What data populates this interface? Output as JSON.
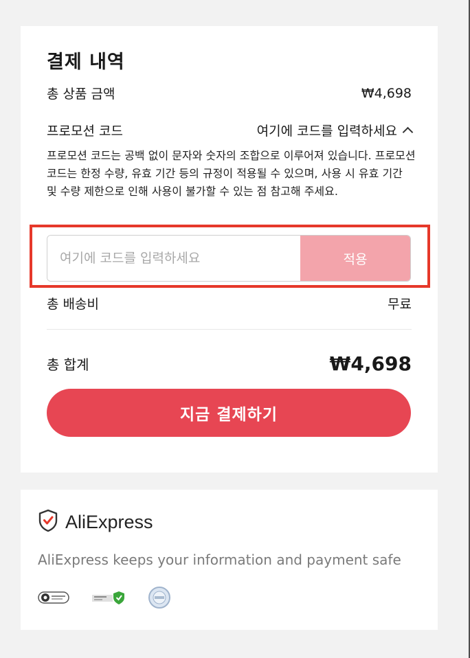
{
  "summary": {
    "title": "결제 내역",
    "items_label": "총 상품 금액",
    "items_value": "₩4,698",
    "promo_label": "프로모션 코드",
    "promo_toggle": "여기에 코드를 입력하세요",
    "promo_description": "프로모션 코드는 공백 없이 문자와 숫자의 조합으로 이루어져 있습니다. 프로모션 코드는 한정 수량, 유효 기간 등의 규정이 적용될 수 있으며, 사용 시 유효 기간 및 수량 제한으로 인해 사용이 불가할 수 있는 점 참고해 주세요.",
    "code_placeholder": "여기에 코드를 입력하세요",
    "code_value": "",
    "apply_label": "적용",
    "shipping_label": "총 배송비",
    "shipping_value": "무료",
    "total_label": "총 합계",
    "total_value": "₩4,698",
    "pay_label": "지금 결제하기"
  },
  "security": {
    "brand": "AliExpress",
    "message": "AliExpress keeps your information and payment safe",
    "badge_icons": [
      "pci-dss-badge-icon",
      "security-shield-badge-icon",
      "verified-seal-badge-icon"
    ]
  },
  "colors": {
    "accent": "#e74653",
    "apply_disabled": "#f3a4ab",
    "highlight": "#e6382a"
  }
}
